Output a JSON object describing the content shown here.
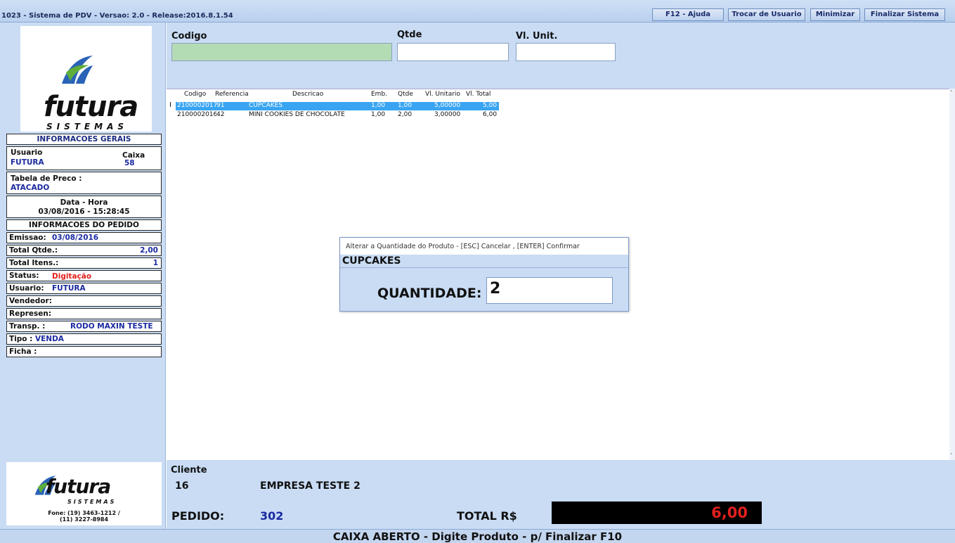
{
  "window": {
    "title": "1023 - Sistema de PDV - Versao: 2.0 - Release:2016.8.1.54",
    "buttons": {
      "help": "F12 - Ajuda",
      "switch_user": "Trocar de Usuario",
      "minimize": "Minimizar",
      "exit": "Finalizar Sistema"
    }
  },
  "logo": {
    "word": "futura",
    "sub": "SISTEMAS",
    "phone": "Fone: (19) 3463-1212 /",
    "phone2": "(11) 3227-8984"
  },
  "info": {
    "general_header": "INFORMACOES GERAIS",
    "user_label": "Usuario",
    "user_value": "FUTURA",
    "caixa_label": "Caixa",
    "caixa_value": "58",
    "price_table_label": "Tabela de Preco :",
    "price_table_value": "ATACADO",
    "datetime_label": "Data - Hora",
    "datetime_value": "03/08/2016 - 15:28:45",
    "order_header": "INFORMACOES DO PEDIDO",
    "emissao_label": "Emissao:",
    "emissao_value": "03/08/2016",
    "total_qtde_label": "Total Qtde.:",
    "total_qtde_value": "2,00",
    "total_itens_label": "Total Itens.:",
    "total_itens_value": "1",
    "status_label": "Status:",
    "status_value": "Digitação",
    "order_user_label": "Usuario:",
    "order_user_value": "FUTURA",
    "vendedor_label": "Vendedor:",
    "represen_label": "Represen:",
    "transp_label": "Transp. :",
    "transp_value": "RODO MAXIN TESTE",
    "tipo_label": "Tipo :",
    "tipo_value": "VENDA",
    "ficha_label": "Ficha :"
  },
  "entry": {
    "codigo_label": "Codigo",
    "qtde_label": "Qtde",
    "vl_unit_label": "Vl. Unit."
  },
  "grid": {
    "headers": [
      "Codigo",
      "Referencia",
      "Descricao",
      "Emb.",
      "Qtde",
      "Vl. Unitario",
      "Vl. Total"
    ],
    "rows": [
      {
        "codigo": "21000020176",
        "referencia": "91",
        "descricao": "CUPCAKES",
        "emb": "1,00",
        "qtde": "1,00",
        "vl_unit": "5,00000",
        "vl_total": "5,00"
      },
      {
        "codigo": "21000020168",
        "referencia": "42",
        "descricao": "MINI COOKIES DE CHOCOLATE",
        "emb": "1,00",
        "qtde": "2,00",
        "vl_unit": "3,00000",
        "vl_total": "6,00"
      }
    ]
  },
  "dialog": {
    "title": "Alterar a Quantidade do Produto - [ESC] Cancelar , [ENTER] Confirmar",
    "product": "CUPCAKES",
    "qty_label": "QUANTIDADE:",
    "qty_value": "2"
  },
  "bottom": {
    "cliente_label": "Cliente",
    "cliente_code": "16",
    "cliente_name": "EMPRESA TESTE 2",
    "pedido_label": "PEDIDO:",
    "pedido_value": "302",
    "total_label": "TOTAL R$",
    "total_value": "6,00"
  },
  "status": {
    "text": "CAIXA ABERTO - Digite Produto - p/ Finalizar F10"
  },
  "colors": {
    "panel": "#c9dcf4",
    "selected_row": "#39a5f2",
    "codigo_input": "#b4dcb4",
    "total_text": "#e2201e"
  }
}
